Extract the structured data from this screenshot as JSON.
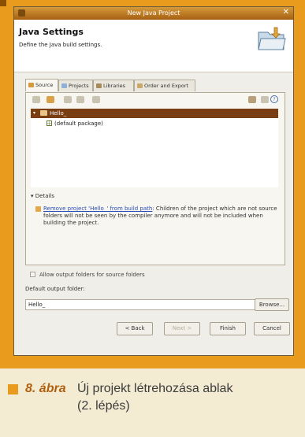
{
  "window": {
    "title": "New Java Project",
    "close_glyph": "✕"
  },
  "banner": {
    "heading": "Java Settings",
    "description": "Define the Java build settings."
  },
  "tabs": [
    {
      "label": "Source",
      "color": "#d59a3c"
    },
    {
      "label": "Projects",
      "color": "#8fb0d8"
    },
    {
      "label": "Libraries",
      "color": "#a98a5a"
    },
    {
      "label": "Order and Export",
      "color": "#caa86a"
    }
  ],
  "tree": {
    "project": "Hello_",
    "package": "(default package)"
  },
  "details": {
    "toggle": "Details",
    "link": "Remove project 'Hello_' from build path",
    "text": ": Children of the project which are not source folders will not be seen by the compiler anymore and will not be included when building the project."
  },
  "options": {
    "allow_output_folders": "Allow output folders for source folders"
  },
  "output": {
    "label": "Default output folder:",
    "value": "Hello_",
    "browse": "Browse..."
  },
  "buttons": {
    "back": "< Back",
    "next": "Next >",
    "finish": "Finish",
    "cancel": "Cancel"
  },
  "caption": {
    "figure": "8. ábra",
    "line1": "Új projekt létrehozása ablak",
    "line2": "(2. lépés)"
  },
  "colors": {
    "frame": "#e99b1e",
    "selection": "#7a3e13",
    "link": "#2a4db8"
  }
}
